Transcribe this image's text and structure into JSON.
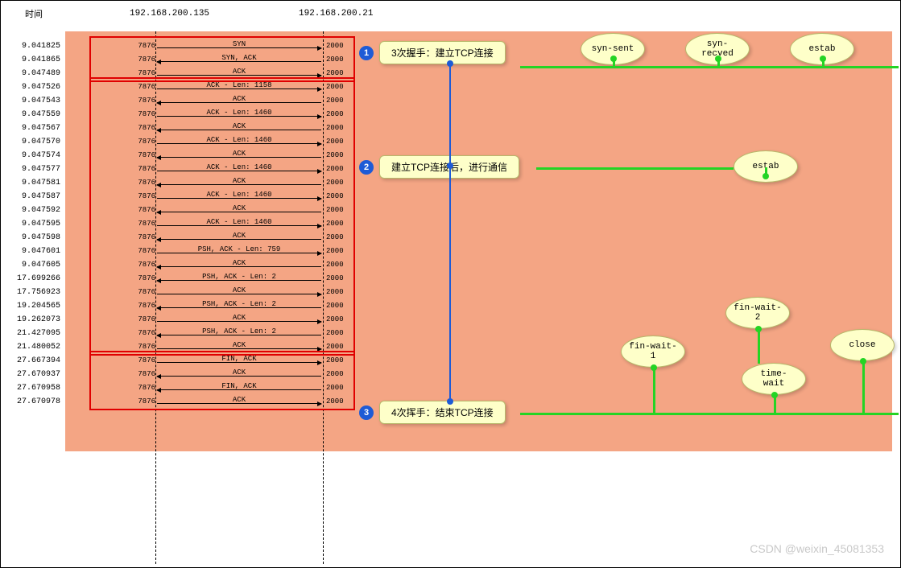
{
  "header": {
    "time_label": "时间"
  },
  "hosts": {
    "left_ip": "192.168.200.135",
    "right_ip": "192.168.200.21"
  },
  "ports": {
    "left": "7876",
    "right": "2000"
  },
  "rows": [
    {
      "t": "9.041825",
      "lbl": "SYN",
      "dir": "r"
    },
    {
      "t": "9.041865",
      "lbl": "SYN, ACK",
      "dir": "l"
    },
    {
      "t": "9.047489",
      "lbl": "ACK",
      "dir": "r"
    },
    {
      "t": "9.047526",
      "lbl": "ACK - Len: 1158",
      "dir": "r"
    },
    {
      "t": "9.047543",
      "lbl": "ACK",
      "dir": "l"
    },
    {
      "t": "9.047559",
      "lbl": "ACK - Len: 1460",
      "dir": "r"
    },
    {
      "t": "9.047567",
      "lbl": "ACK",
      "dir": "l"
    },
    {
      "t": "9.047570",
      "lbl": "ACK - Len: 1460",
      "dir": "r"
    },
    {
      "t": "9.047574",
      "lbl": "ACK",
      "dir": "l"
    },
    {
      "t": "9.047577",
      "lbl": "ACK - Len: 1460",
      "dir": "r"
    },
    {
      "t": "9.047581",
      "lbl": "ACK",
      "dir": "l"
    },
    {
      "t": "9.047587",
      "lbl": "ACK - Len: 1460",
      "dir": "r"
    },
    {
      "t": "9.047592",
      "lbl": "ACK",
      "dir": "l"
    },
    {
      "t": "9.047595",
      "lbl": "ACK - Len: 1460",
      "dir": "r"
    },
    {
      "t": "9.047598",
      "lbl": "ACK",
      "dir": "l"
    },
    {
      "t": "9.047601",
      "lbl": "PSH, ACK - Len: 759",
      "dir": "r"
    },
    {
      "t": "9.047605",
      "lbl": "ACK",
      "dir": "l"
    },
    {
      "t": "17.699266",
      "lbl": "PSH, ACK - Len: 2",
      "dir": "l"
    },
    {
      "t": "17.756923",
      "lbl": "ACK",
      "dir": "r"
    },
    {
      "t": "19.204565",
      "lbl": "PSH, ACK - Len: 2",
      "dir": "l"
    },
    {
      "t": "19.262073",
      "lbl": "ACK",
      "dir": "r"
    },
    {
      "t": "21.427095",
      "lbl": "PSH, ACK - Len: 2",
      "dir": "l"
    },
    {
      "t": "21.480052",
      "lbl": "ACK",
      "dir": "r"
    },
    {
      "t": "27.667394",
      "lbl": "FIN, ACK",
      "dir": "r"
    },
    {
      "t": "27.670937",
      "lbl": "ACK",
      "dir": "l"
    },
    {
      "t": "27.670958",
      "lbl": "FIN, ACK",
      "dir": "l"
    },
    {
      "t": "27.670978",
      "lbl": "ACK",
      "dir": "r"
    }
  ],
  "groups": [
    {
      "from": 0,
      "to": 2
    },
    {
      "from": 3,
      "to": 22
    },
    {
      "from": 23,
      "to": 26
    }
  ],
  "annotations": {
    "n1": "1",
    "t1": "3次握手：建立TCP连接",
    "n2": "2",
    "t2": "建立TCP连接后，进行通信",
    "n3": "3",
    "t3": "4次挥手：结束TCP连接"
  },
  "states": {
    "syn_sent": "syn-sent",
    "syn_recved": "syn-\nrecved",
    "estab1": "estab",
    "estab2": "estab",
    "fin_wait_1": "fin-wait-\n1",
    "fin_wait_2": "fin-wait-\n2",
    "time_wait": "time-\nwait",
    "close": "close"
  },
  "watermark": "CSDN @weixin_45081353"
}
